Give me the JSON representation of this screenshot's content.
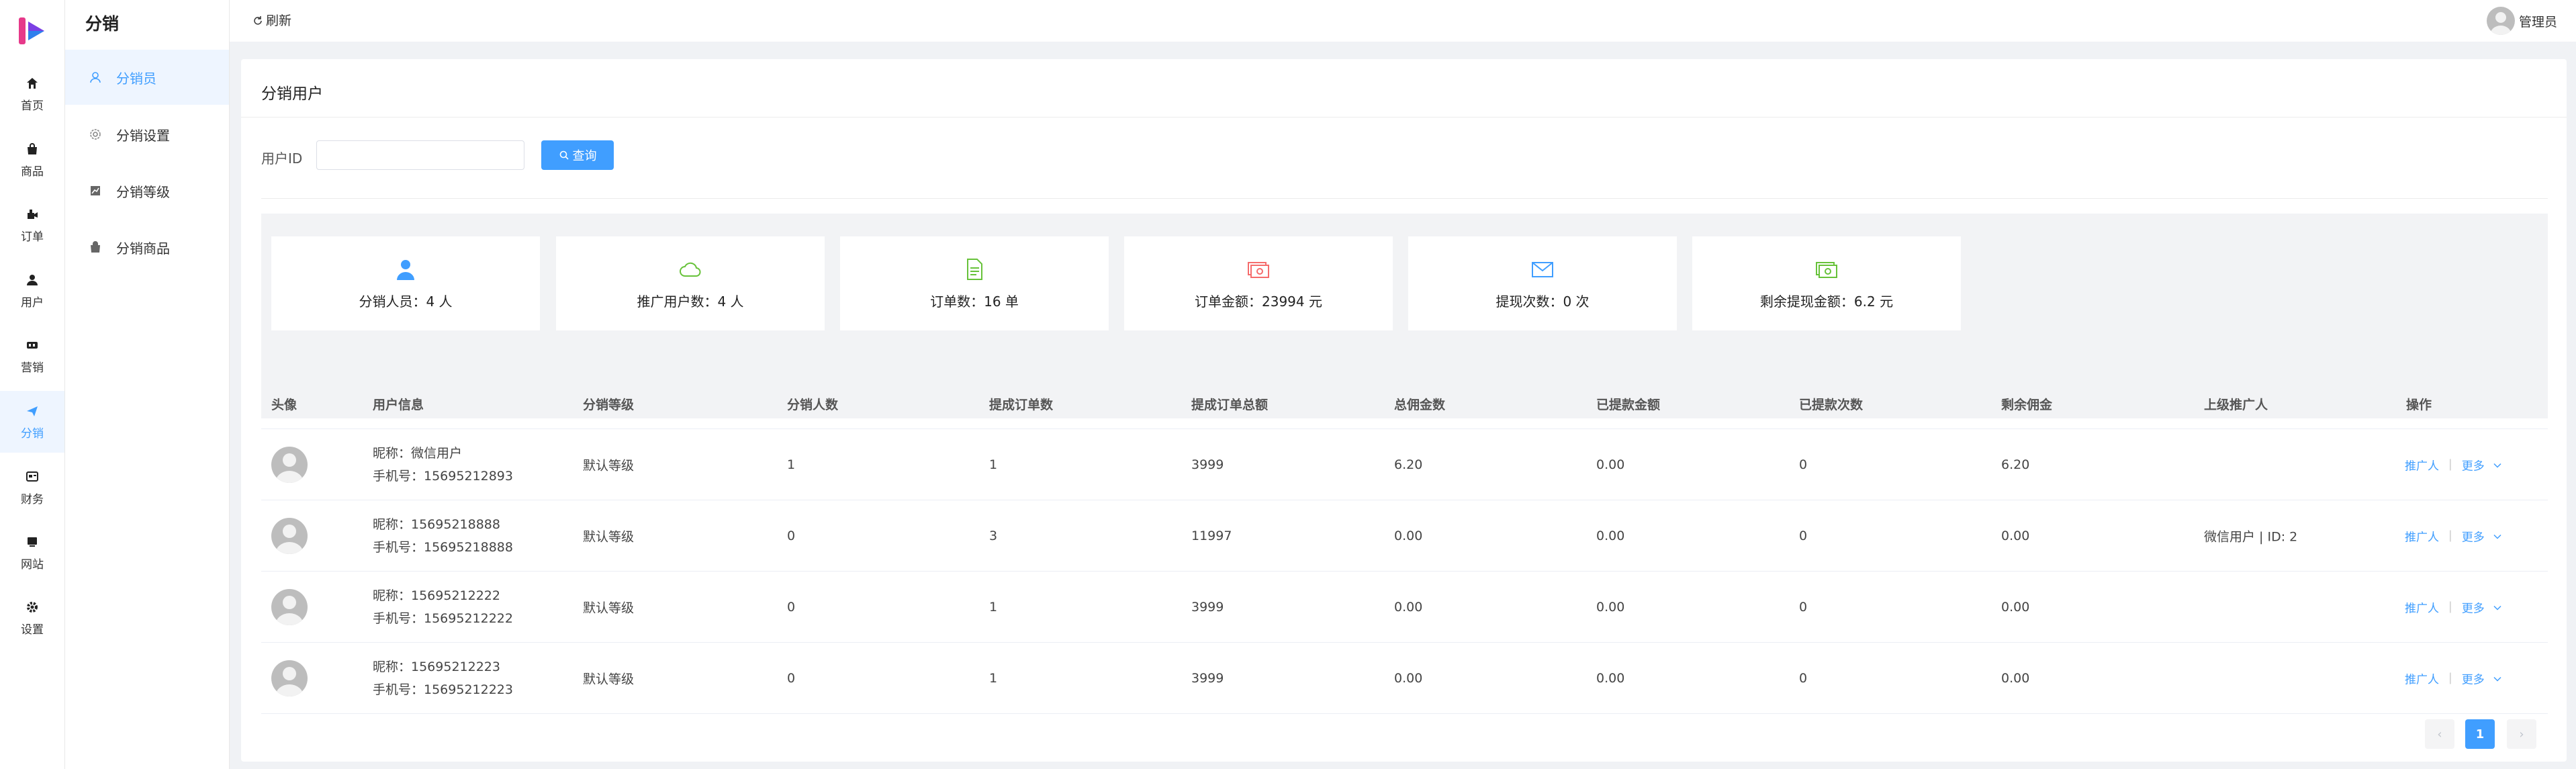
{
  "rail": {
    "items": [
      {
        "label": "首页",
        "icon": "home-icon"
      },
      {
        "label": "商品",
        "icon": "shopping-bag-icon"
      },
      {
        "label": "订单",
        "icon": "order-icon"
      },
      {
        "label": "用户",
        "icon": "user-icon"
      },
      {
        "label": "营销",
        "icon": "marketing-icon"
      },
      {
        "label": "分销",
        "icon": "paper-plane-icon",
        "active": true
      },
      {
        "label": "财务",
        "icon": "finance-icon"
      },
      {
        "label": "网站",
        "icon": "website-icon"
      },
      {
        "label": "设置",
        "icon": "gear-icon"
      }
    ]
  },
  "submenu": {
    "title": "分销",
    "items": [
      {
        "label": "分销员",
        "icon": "user-outline-icon",
        "active": true
      },
      {
        "label": "分销设置",
        "icon": "settings-outline-icon"
      },
      {
        "label": "分销等级",
        "icon": "level-chart-icon"
      },
      {
        "label": "分销商品",
        "icon": "goods-bag-icon"
      }
    ]
  },
  "topbar": {
    "refresh_label": "刷新",
    "admin_label": "管理员"
  },
  "page": {
    "title": "分销用户",
    "search_label": "用户ID",
    "search_value": "",
    "search_button": "查询"
  },
  "stats": [
    {
      "label": "分销人员：4 人",
      "icon": "person-icon",
      "color": "#409eff"
    },
    {
      "label": "推广用户数：4 人",
      "icon": "cloud-icon",
      "color": "#67c23a"
    },
    {
      "label": "订单数：16 单",
      "icon": "document-icon",
      "color": "#67c23a"
    },
    {
      "label": "订单金额：23994 元",
      "icon": "money-icon",
      "color": "#f56c6c"
    },
    {
      "label": "提现次数：0 次",
      "icon": "envelope-icon",
      "color": "#409eff"
    },
    {
      "label": "剩余提现金额：6.2 元",
      "icon": "cash-icon",
      "color": "#67c23a"
    }
  ],
  "table": {
    "headers": [
      "头像",
      "用户信息",
      "分销等级",
      "分销人数",
      "提成订单数",
      "提成订单总额",
      "总佣金数",
      "已提款金额",
      "已提款次数",
      "剩余佣金",
      "上级推广人",
      "操作"
    ],
    "rows": [
      {
        "nickname": "昵称：微信用户",
        "phone": "手机号：15695212893",
        "level": "默认等级",
        "count": "1",
        "orders": "1",
        "order_total": "3999",
        "commission": "6.20",
        "withdrawn": "0.00",
        "withdraw_times": "0",
        "remaining": "6.20",
        "parent": ""
      },
      {
        "nickname": "昵称：15695218888",
        "phone": "手机号：15695218888",
        "level": "默认等级",
        "count": "0",
        "orders": "3",
        "order_total": "11997",
        "commission": "0.00",
        "withdrawn": "0.00",
        "withdraw_times": "0",
        "remaining": "0.00",
        "parent": "微信用户 | ID: 2"
      },
      {
        "nickname": "昵称：15695212222",
        "phone": "手机号：15695212222",
        "level": "默认等级",
        "count": "0",
        "orders": "1",
        "order_total": "3999",
        "commission": "0.00",
        "withdrawn": "0.00",
        "withdraw_times": "0",
        "remaining": "0.00",
        "parent": ""
      },
      {
        "nickname": "昵称：15695212223",
        "phone": "手机号：15695212223",
        "level": "默认等级",
        "count": "0",
        "orders": "1",
        "order_total": "3999",
        "commission": "0.00",
        "withdrawn": "0.00",
        "withdraw_times": "0",
        "remaining": "0.00",
        "parent": ""
      }
    ],
    "op_promoter": "推广人",
    "op_sep": "|",
    "op_more": "更多"
  },
  "pagination": {
    "current": "1",
    "prev_symbol": "‹",
    "next_symbol": "›"
  },
  "colors": {
    "accent": "#409eff",
    "logo_pink": "#e6398a",
    "logo_purple": "#7b3fe4",
    "logo_blue": "#2f80ed"
  }
}
